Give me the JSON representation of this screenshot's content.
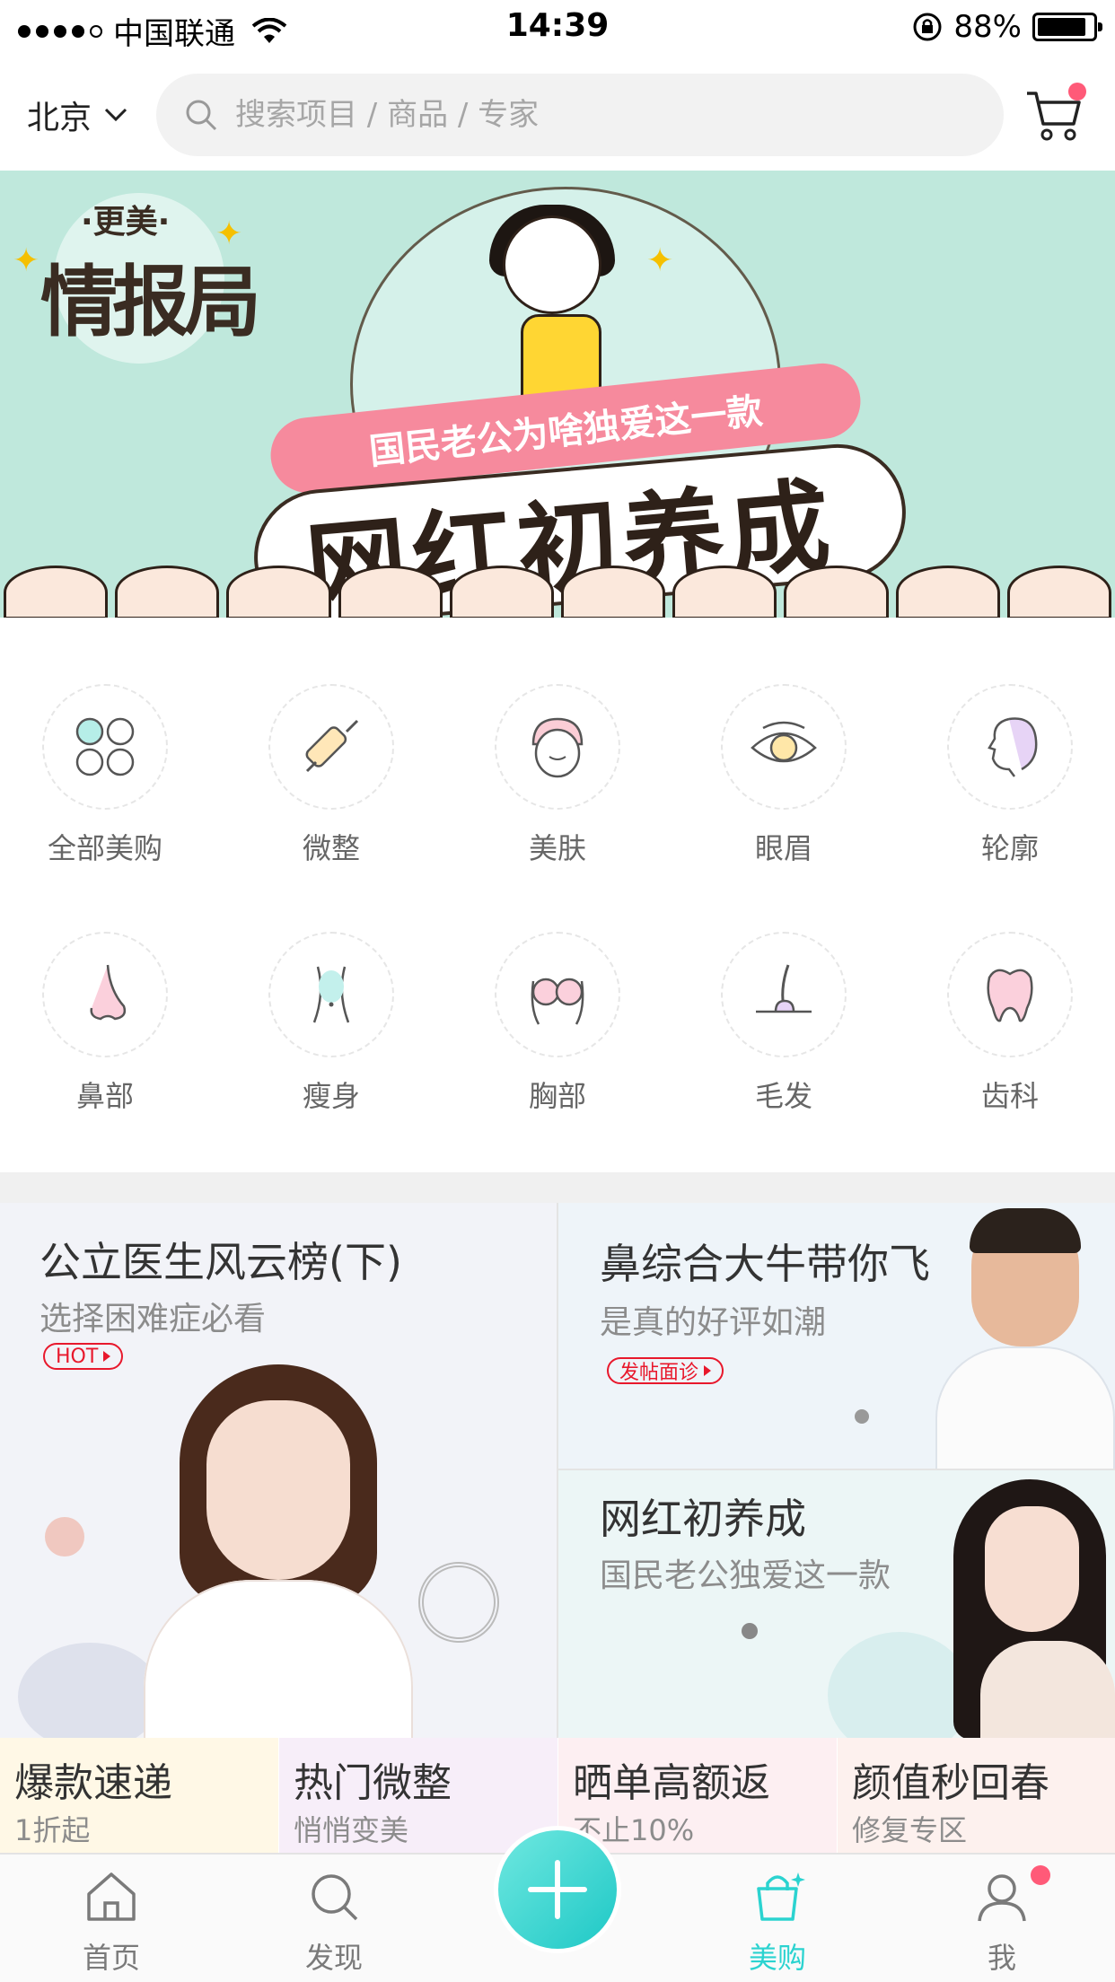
{
  "status_bar": {
    "carrier": "中国联通",
    "time": "14:39",
    "battery": "88%",
    "battery_level": 0.88
  },
  "header": {
    "city": "北京",
    "search_placeholder": "搜索项目 / 商品 / 专家",
    "icons": [
      "chevron-down-icon",
      "search-icon",
      "cart-icon"
    ]
  },
  "banner": {
    "logo_small": "·更美·",
    "logo_big": "情报局",
    "ribbon": "国民老公为啥独爱这一款",
    "title": "网红初养成"
  },
  "categories": [
    {
      "label": "全部美购",
      "icon": "clover-icon"
    },
    {
      "label": "微整",
      "icon": "syringe-icon"
    },
    {
      "label": "美肤",
      "icon": "face-towel-icon"
    },
    {
      "label": "眼眉",
      "icon": "eye-icon"
    },
    {
      "label": "轮廓",
      "icon": "face-profile-icon"
    },
    {
      "label": "鼻部",
      "icon": "nose-icon"
    },
    {
      "label": "瘦身",
      "icon": "waist-icon"
    },
    {
      "label": "胸部",
      "icon": "chest-icon"
    },
    {
      "label": "毛发",
      "icon": "hair-icon"
    },
    {
      "label": "齿科",
      "icon": "tooth-icon"
    }
  ],
  "promos": {
    "left": {
      "title": "公立医生风云榜(下)",
      "subtitle": "选择困难症必看",
      "tag": "HOT"
    },
    "right_top": {
      "title": "鼻综合大牛带你飞",
      "subtitle": "是真的好评如潮",
      "tag": "发帖面诊"
    },
    "right_bottom": {
      "title": "网红初养成",
      "subtitle": "国民老公独爱这一款"
    }
  },
  "bottom_row": [
    {
      "title": "爆款速递",
      "subtitle": "1折起",
      "bg": "#fff8e6"
    },
    {
      "title": "热门微整",
      "subtitle": "悄悄变美",
      "bg": "#f7eef9"
    },
    {
      "title": "晒单高额返",
      "subtitle": "不止10%",
      "bg": "#fdeff2"
    },
    {
      "title": "颜值秒回春",
      "subtitle": "修复专区",
      "bg": "#fdf1ee"
    }
  ],
  "tabbar": {
    "home": "首页",
    "discover": "发现",
    "shop": "美购",
    "me": "我",
    "active": "美购"
  },
  "colors": {
    "accent": "#2bd3d0",
    "badge": "#ff5a78",
    "hot": "#e8182c"
  }
}
